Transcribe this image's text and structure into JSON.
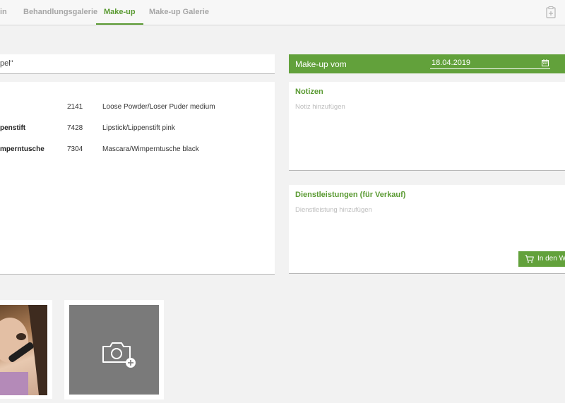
{
  "nav": {
    "tabs": [
      {
        "label": "in"
      },
      {
        "label": "Behandlungsgalerie"
      },
      {
        "label": "Make-up"
      },
      {
        "label": "Make-up Galerie"
      }
    ],
    "active_tab": "Make-up",
    "right_icon": "clipboard-plus-icon"
  },
  "search": {
    "value": "pel\""
  },
  "products": [
    {
      "name": "",
      "number": "2141",
      "description": "Loose Powder/Loser Puder medium"
    },
    {
      "name": "penstift",
      "number": "7428",
      "description": "Lipstick/Lippenstift pink"
    },
    {
      "name": "mperntusche",
      "number": "7304",
      "description": "Mascara/Wimperntusche black"
    }
  ],
  "makeup_header": {
    "label": "Make-up vom",
    "date": "18.04.2019",
    "icon": "calendar-icon"
  },
  "notes": {
    "title": "Notizen",
    "placeholder": "Notiz hinzufügen"
  },
  "services": {
    "title": "Dienstleistungen (für Verkauf)",
    "placeholder": "Dienstleistung hinzufügen",
    "cart_button": "In den W",
    "cart_icon": "shopping-cart-icon"
  },
  "gallery": {
    "add_photo_icon": "camera-add-icon"
  },
  "colors": {
    "accent": "#62a13b",
    "accent_text": "#5a9a32",
    "background": "#f2f2f2"
  }
}
